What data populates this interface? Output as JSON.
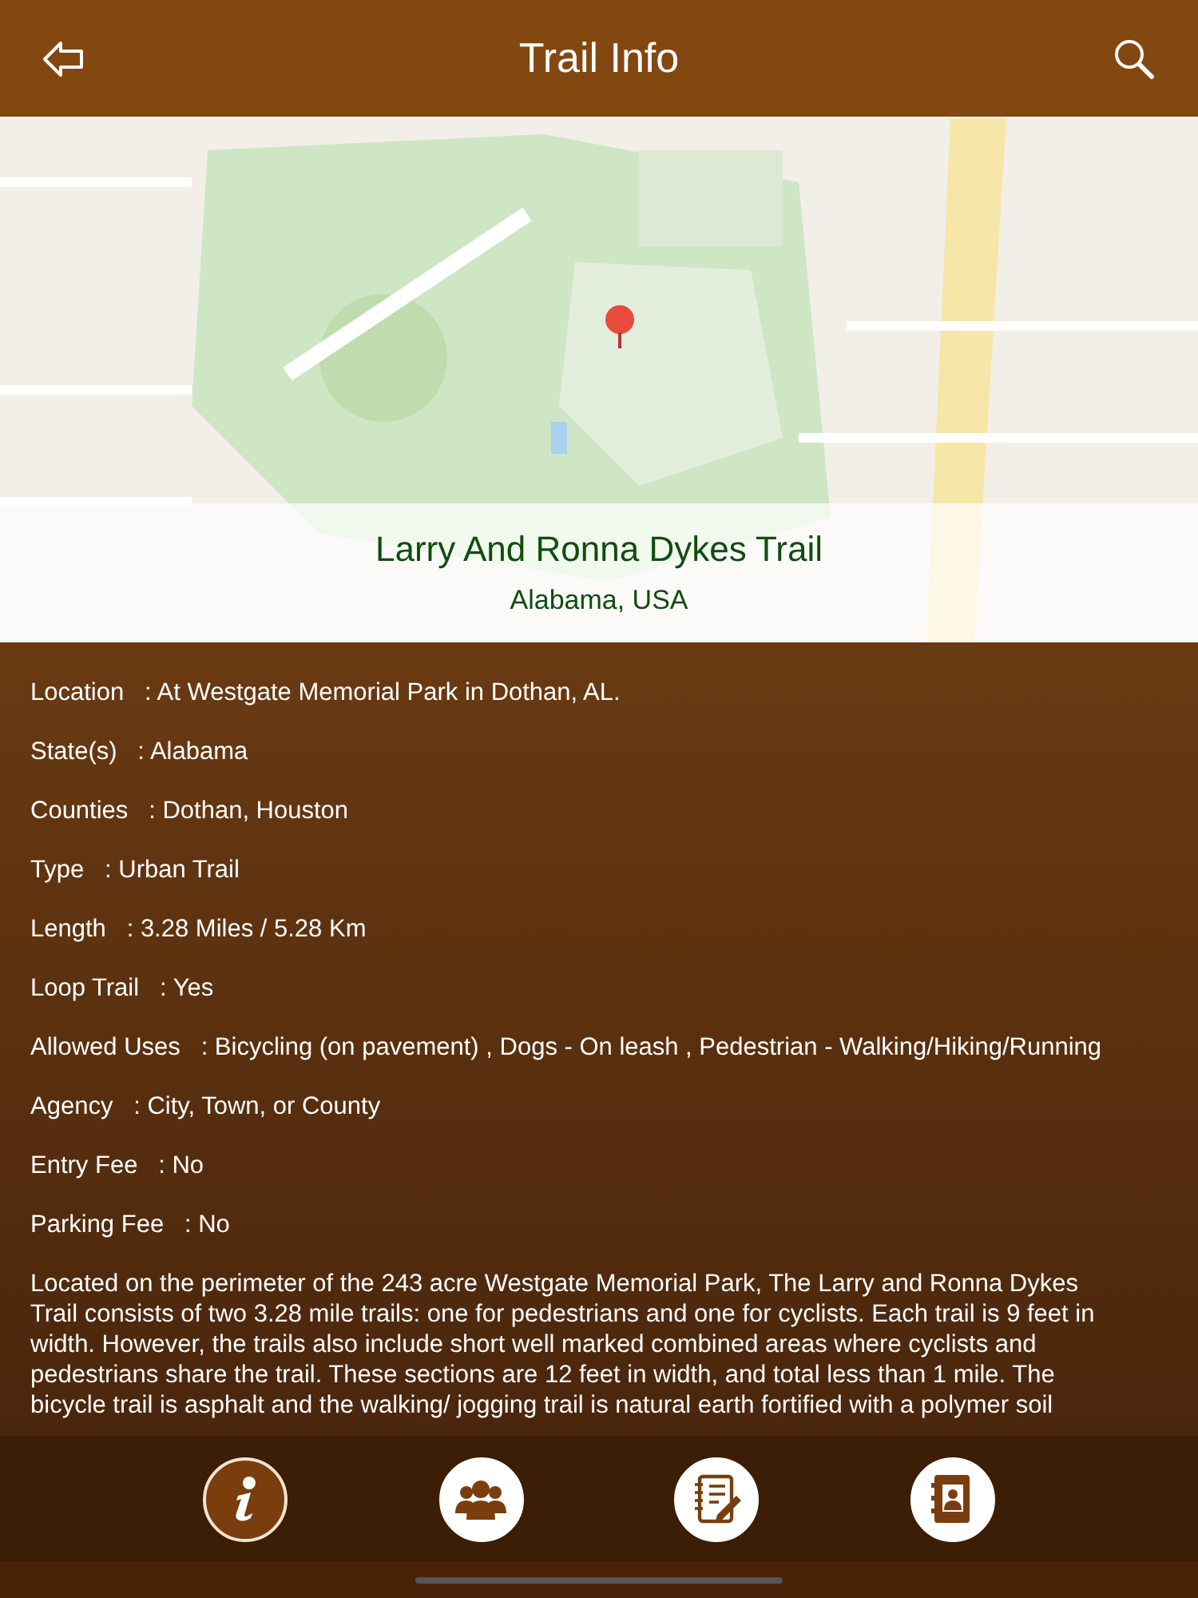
{
  "header": {
    "title": "Trail Info"
  },
  "map": {
    "kind": "picture",
    "trail_name": "Larry And Ronna Dykes Trail",
    "region": "Alabama, USA"
  },
  "details": [
    {
      "label": "Location   :",
      "value": "At Westgate Memorial Park in Dothan, AL."
    },
    {
      "label": "State(s)   :",
      "value": "Alabama"
    },
    {
      "label": "Counties   :",
      "value": "Dothan, Houston"
    },
    {
      "label": "Type   :",
      "value": "Urban Trail"
    },
    {
      "label": "Length   :",
      "value": "3.28 Miles / 5.28 Km"
    },
    {
      "label": "Loop Trail   :",
      "value": "Yes"
    },
    {
      "label": "Allowed Uses   :",
      "value": "Bicycling (on pavement) , Dogs - On leash , Pedestrian - Walking/Hiking/Running"
    },
    {
      "label": "Agency   :",
      "value": "City, Town, or County"
    },
    {
      "label": "Entry Fee   :",
      "value": "No"
    },
    {
      "label": "Parking Fee   :",
      "value": "No"
    }
  ],
  "description": "Located on the perimeter of the 243 acre Westgate Memorial Park, The Larry and Ronna Dykes Trail consists of two 3.28 mile trails: one for pedestrians and one for cyclists. Each trail is 9 feet in width. However, the trails also include short well marked combined areas where cyclists and pedestrians share the trail. These sections are 12 feet in width, and total less than 1 mile. The bicycle trail is asphalt and the walking/ jogging trail is natural earth fortified with a polymer soil",
  "tabs": [
    {
      "kind": "info",
      "selected": true
    },
    {
      "kind": "people",
      "selected": false
    },
    {
      "kind": "notes",
      "selected": false
    },
    {
      "kind": "contacts",
      "selected": false
    }
  ]
}
